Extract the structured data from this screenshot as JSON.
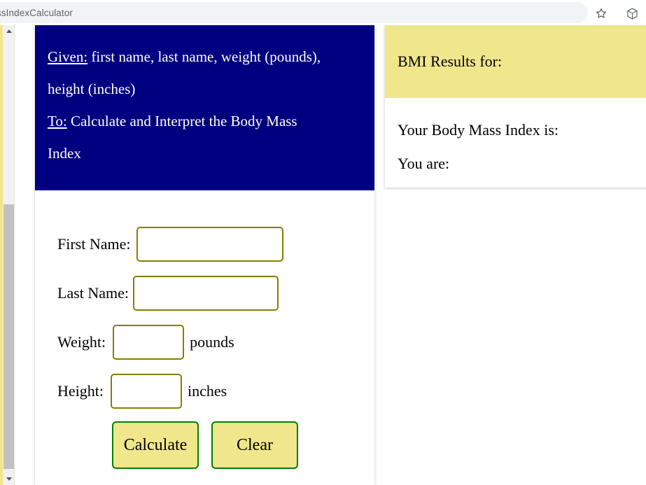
{
  "browser": {
    "url_text": "MassIndexCalculator",
    "star_icon": "star-icon",
    "extensions_icon": "extensions-cube-icon"
  },
  "scrollbar": {
    "up_arrow": "scroll-up-arrow-icon",
    "down_arrow": "scroll-down-arrow-icon"
  },
  "instructions": {
    "line1_key": "Given:",
    "line1_rest": " first name, last name, weight (pounds),",
    "line2": "height (inches)",
    "line3_key": "To:",
    "line3_rest": " Calculate and Interpret the Body Mass",
    "line4": "Index"
  },
  "form": {
    "first_name_label": "First Name:",
    "first_name_value": "",
    "first_name_placeholder": "",
    "last_name_label": "Last Name:",
    "last_name_value": "",
    "last_name_placeholder": "",
    "weight_label": "Weight:",
    "weight_value": "",
    "weight_placeholder": "",
    "weight_unit": "pounds",
    "height_label": "Height:",
    "height_value": "",
    "height_placeholder": "",
    "height_unit": "inches",
    "calculate_button": "Calculate",
    "clear_button": "Clear"
  },
  "results": {
    "header": "BMI Results for:",
    "bmi_line": "Your Body Mass Index is:",
    "category_line": "You are:"
  },
  "colors": {
    "panel_navy": "#000080",
    "panel_khaki": "#f0e68c",
    "input_border_olive": "#808000",
    "button_border_green": "#008000",
    "page_white": "#ffffff",
    "chrome_omnibox": "#f1f3f4",
    "scrollbar_track": "#f1f1f1",
    "scrollbar_thumb": "#c1c1c1"
  }
}
